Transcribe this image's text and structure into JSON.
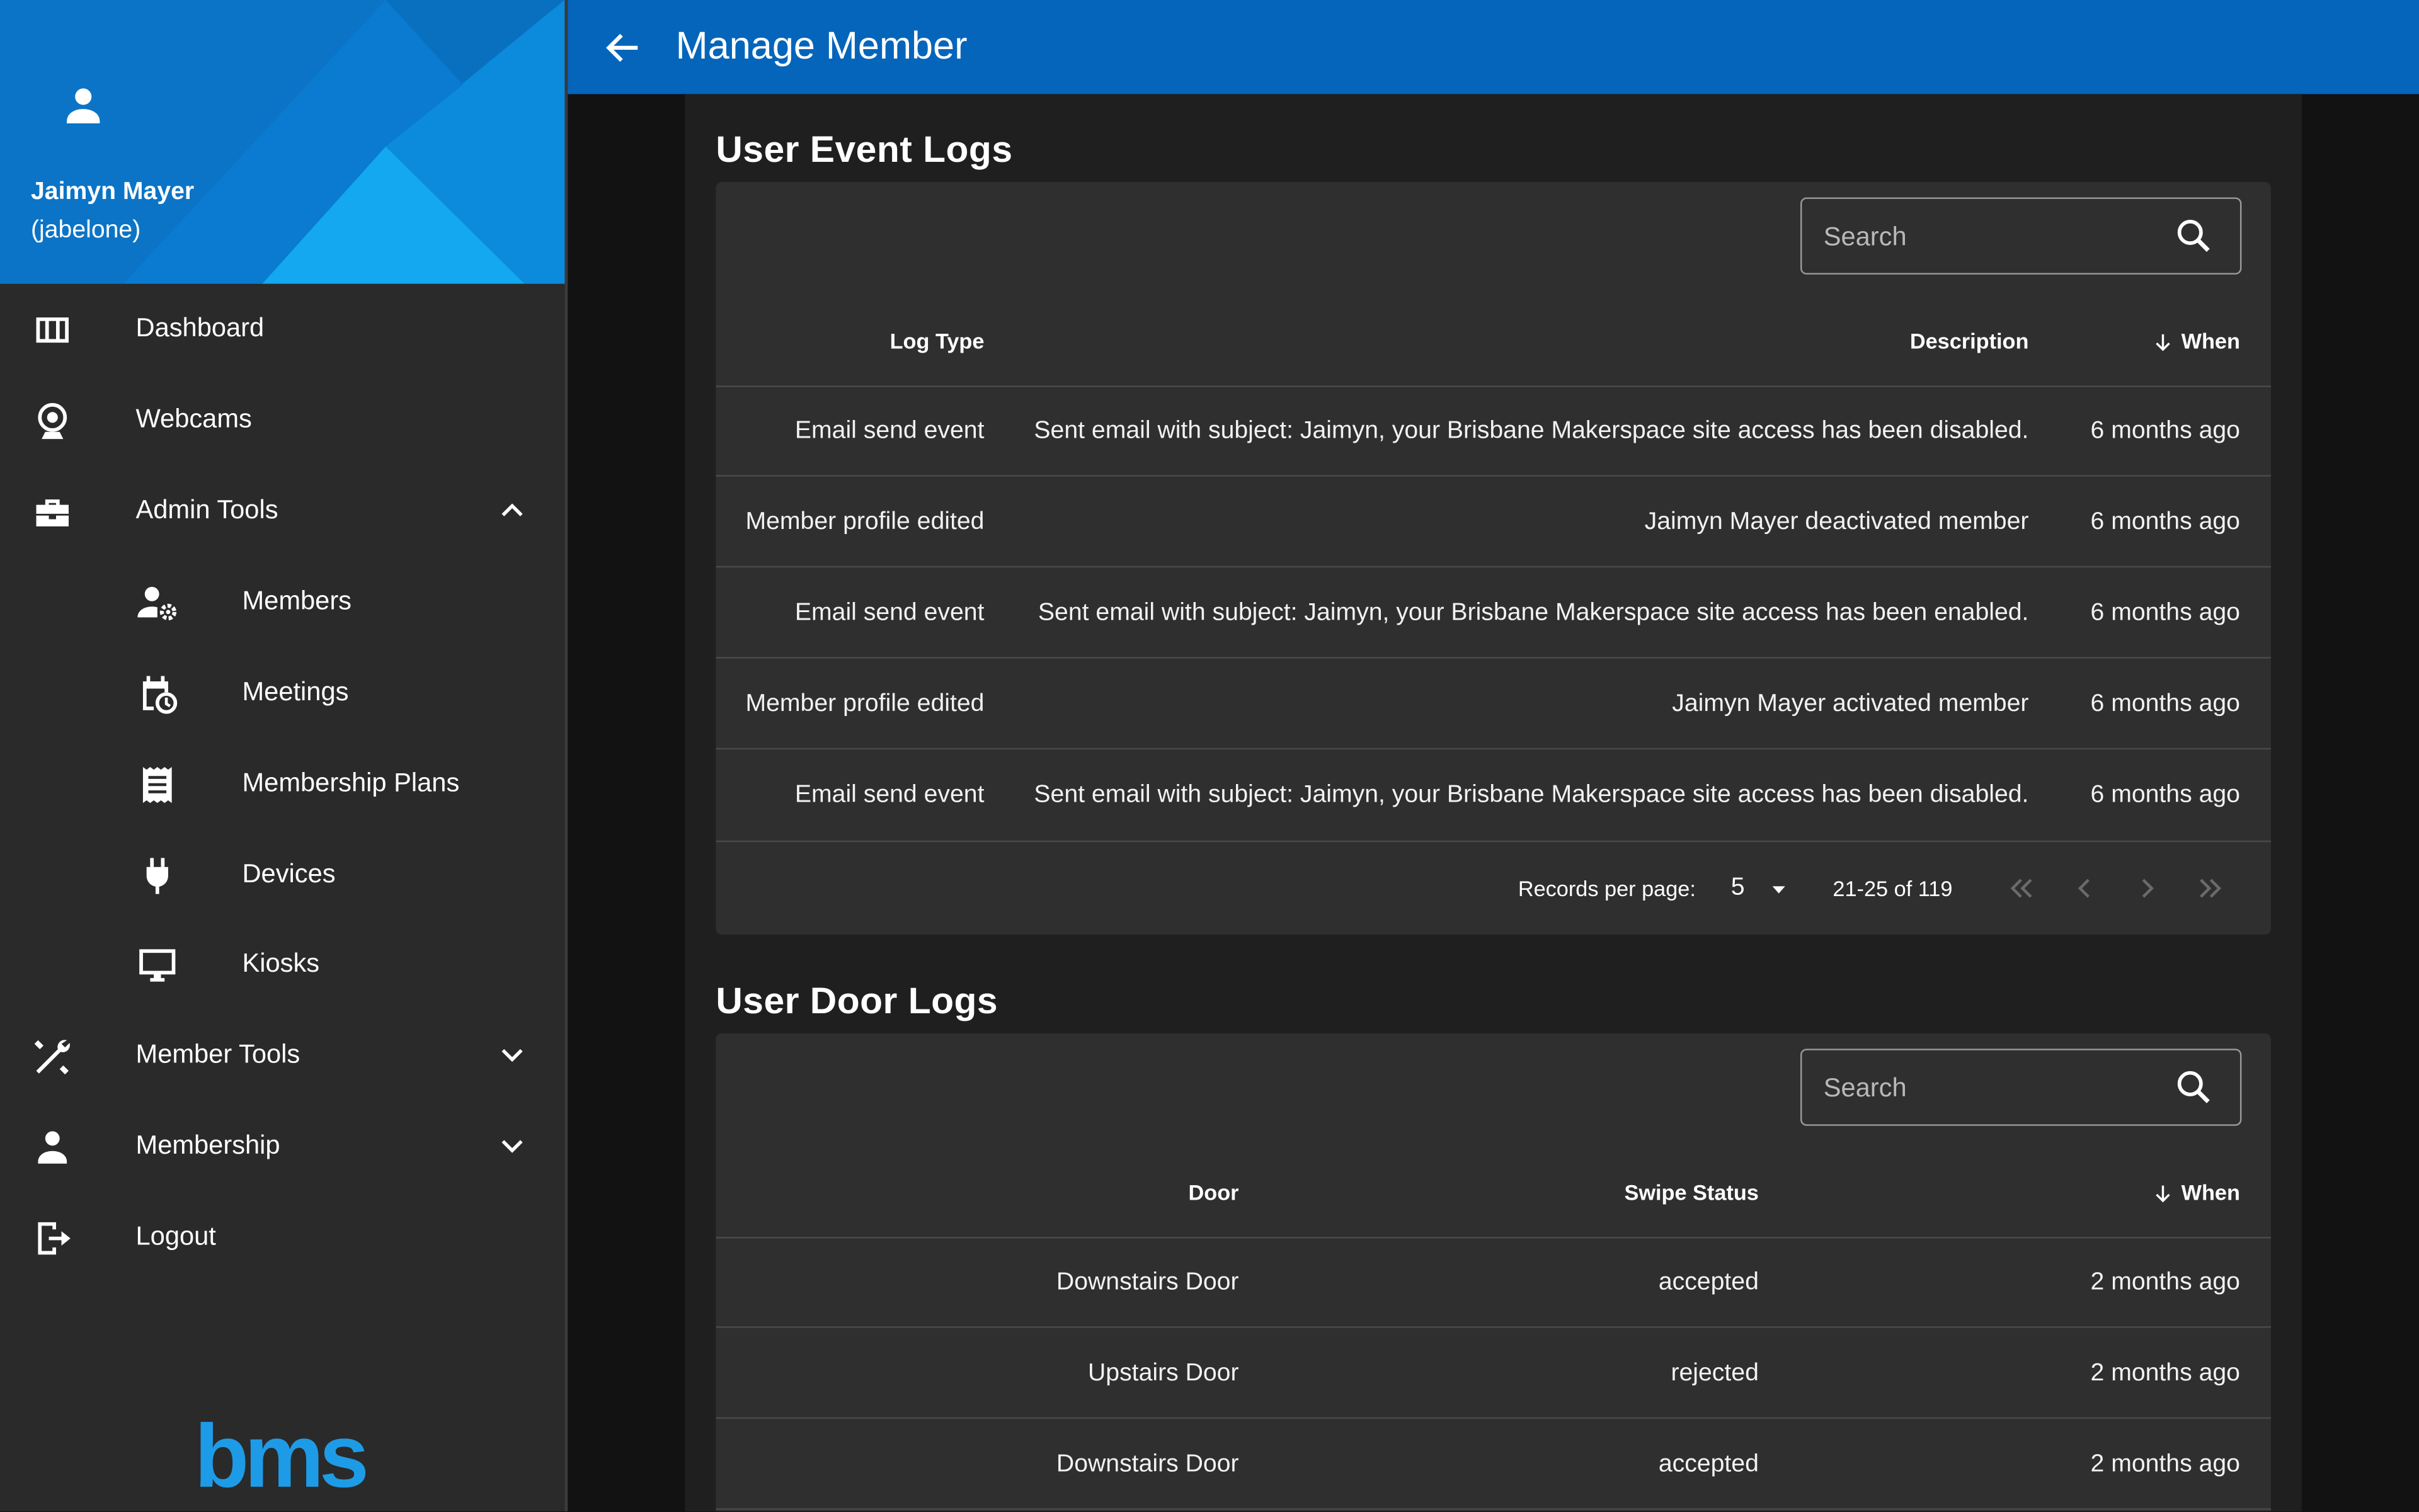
{
  "app_bar": {
    "title": "Manage Member"
  },
  "drawer": {
    "user_name": "Jaimyn Mayer",
    "user_handle": "(jabelone)",
    "items": [
      {
        "label": "Dashboard",
        "icon": "dashboard-icon"
      },
      {
        "label": "Webcams",
        "icon": "webcam-icon"
      },
      {
        "label": "Admin Tools",
        "icon": "toolbox-icon",
        "expanded": true
      },
      {
        "label": "Members",
        "icon": "member-settings-icon"
      },
      {
        "label": "Meetings",
        "icon": "calendar-clock-icon"
      },
      {
        "label": "Membership Plans",
        "icon": "receipt-icon"
      },
      {
        "label": "Devices",
        "icon": "power-plug-icon"
      },
      {
        "label": "Kiosks",
        "icon": "monitor-icon"
      },
      {
        "label": "Member Tools",
        "icon": "tools-icon",
        "expanded": false
      },
      {
        "label": "Membership",
        "icon": "person-icon",
        "expanded": false
      },
      {
        "label": "Logout",
        "icon": "logout-icon"
      }
    ],
    "brand": "bms"
  },
  "event_logs": {
    "title": "User Event Logs",
    "search_placeholder": "Search",
    "headers": {
      "log_type": "Log Type",
      "description": "Description",
      "when": "When"
    },
    "rows": [
      {
        "log_type": "Email send event",
        "description": "Sent email with subject: Jaimyn, your Brisbane Makerspace site access has been disabled.",
        "when": "6 months ago"
      },
      {
        "log_type": "Member profile edited",
        "description": "Jaimyn Mayer deactivated member",
        "when": "6 months ago"
      },
      {
        "log_type": "Email send event",
        "description": "Sent email with subject: Jaimyn, your Brisbane Makerspace site access has been enabled.",
        "when": "6 months ago"
      },
      {
        "log_type": "Member profile edited",
        "description": "Jaimyn Mayer activated member",
        "when": "6 months ago"
      },
      {
        "log_type": "Email send event",
        "description": "Sent email with subject: Jaimyn, your Brisbane Makerspace site access has been disabled.",
        "when": "6 months ago"
      }
    ],
    "footer": {
      "records_label": "Records per page:",
      "records_value": "5",
      "range": "21-25 of 119"
    }
  },
  "door_logs": {
    "title": "User Door Logs",
    "search_placeholder": "Search",
    "headers": {
      "door": "Door",
      "swipe_status": "Swipe Status",
      "when": "When"
    },
    "rows": [
      {
        "door": "Downstairs Door",
        "swipe_status": "accepted",
        "when": "2 months ago"
      },
      {
        "door": "Upstairs Door",
        "swipe_status": "rejected",
        "when": "2 months ago"
      },
      {
        "door": "Downstairs Door",
        "swipe_status": "accepted",
        "when": "2 months ago"
      }
    ]
  },
  "colors": {
    "app_bar": "#0565bb",
    "drawer_header": "#0a7fd4",
    "drawer": "#2a2a2a",
    "card": "#2f2f2f",
    "brand": "#1e9be6"
  }
}
